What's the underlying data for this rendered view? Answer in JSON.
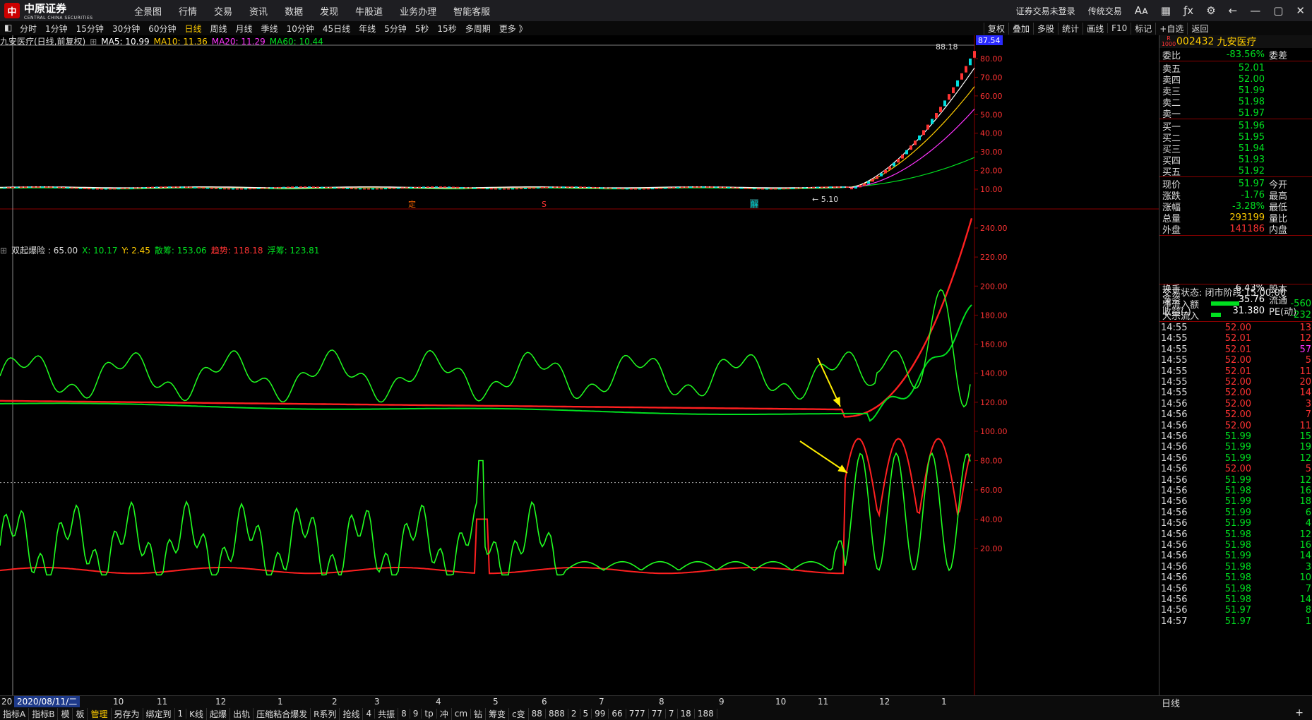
{
  "brand": {
    "name": "中原证券",
    "subtitle": "CENTRAL CHINA SECURITIES"
  },
  "menu": [
    "全景图",
    "行情",
    "交易",
    "资讯",
    "数据",
    "发现",
    "牛股道",
    "业务办理",
    "智能客服"
  ],
  "top_right": {
    "login": "证券交易未登录",
    "mode": "传统交易"
  },
  "periods": [
    "分时",
    "1分钟",
    "15分钟",
    "30分钟",
    "60分钟",
    "日线",
    "周线",
    "月线",
    "季线",
    "10分钟",
    "45日线",
    "年线",
    "5分钟",
    "5秒",
    "15秒",
    "多周期",
    "更多 》"
  ],
  "active_period": "日线",
  "tools": [
    "复权",
    "叠加",
    "多股",
    "统计",
    "画线",
    "F10",
    "标记",
    "+自选",
    "返回"
  ],
  "info": {
    "name": "九安医疗(日线,前复权)",
    "ma5": "MA5: 10.99",
    "ma10": "MA10: 11.36",
    "ma20": "MA20: 11.29",
    "ma60": "MA60: 10.44"
  },
  "indicator": {
    "name": "双起爆险 : 65.00",
    "x": "X: 10.17",
    "y": "Y: 2.45",
    "sanchou": "散筹: 153.06",
    "qushi": "趋势: 118.18",
    "fuchou": "浮筹: 123.81"
  },
  "price_panel": {
    "last_label": "87.54",
    "high_label": "88.18",
    "low_label": "← 5.10",
    "markers": [
      "定",
      "S",
      "解"
    ],
    "y_ticks": [
      "80.00",
      "70.00",
      "60.00",
      "50.00",
      "40.00",
      "30.00",
      "20.00",
      "10.00"
    ]
  },
  "ind_panel": {
    "y_ticks": [
      "240.00",
      "220.00",
      "200.00",
      "180.00",
      "160.00",
      "140.00",
      "120.00",
      "100.00",
      "80.00",
      "60.00",
      "40.00",
      "20.00"
    ]
  },
  "x_axis": {
    "cursor_date": "2020/08/11/二",
    "left_label": "20",
    "labels": [
      "10",
      "11",
      "12",
      "1",
      "2",
      "3",
      "4",
      "5",
      "6",
      "7",
      "8",
      "9",
      "10",
      "11",
      "12",
      "1"
    ],
    "period_tab": "日线"
  },
  "bottom_tabs": [
    "指标A",
    "指标B",
    "模",
    "板",
    "管理",
    "另存为",
    "绑定到",
    "1",
    "K线",
    "起爆",
    "出轨",
    "压缩粘合爆发",
    "R系列",
    "抢线",
    "4",
    "共振",
    "8",
    "9",
    "tp",
    "冲",
    "cm",
    "钻",
    "筹变",
    "c变",
    "88",
    "888",
    "2",
    "5",
    "99",
    "66",
    "777",
    "77",
    "7",
    "18",
    "188"
  ],
  "active_bottom_tab": "管理",
  "stock": {
    "code": "002432",
    "name": "九安医疗",
    "badge": "R 1000"
  },
  "quote": {
    "weibi": {
      "label": "委比",
      "value": "-83.56%",
      "right": "委差"
    },
    "sells": [
      {
        "label": "卖五",
        "price": "52.01"
      },
      {
        "label": "卖四",
        "price": "52.00"
      },
      {
        "label": "卖三",
        "price": "51.99"
      },
      {
        "label": "卖二",
        "price": "51.98"
      },
      {
        "label": "卖一",
        "price": "51.97"
      }
    ],
    "buys": [
      {
        "label": "买一",
        "price": "51.96"
      },
      {
        "label": "买二",
        "price": "51.95"
      },
      {
        "label": "买三",
        "price": "51.94"
      },
      {
        "label": "买四",
        "price": "51.93"
      },
      {
        "label": "买五",
        "price": "51.92"
      }
    ],
    "stats": [
      {
        "label": "现价",
        "value": "51.97",
        "right": "今开",
        "color": "grn"
      },
      {
        "label": "涨跌",
        "value": "-1.76",
        "right": "最高",
        "color": "grn"
      },
      {
        "label": "涨幅",
        "value": "-3.28%",
        "right": "最低",
        "color": "grn"
      },
      {
        "label": "总量",
        "value": "293199",
        "right": "量比",
        "color": "yel"
      },
      {
        "label": "外盘",
        "value": "141186",
        "right": "内盘",
        "color": "red"
      },
      {
        "label": "换手",
        "value": "6.43%",
        "right": "股本",
        "color": "wht"
      },
      {
        "label": "净资",
        "value": "35.76",
        "right": "流通",
        "color": "wht"
      },
      {
        "label": "收益(-)",
        "value": "31.380",
        "right": "PE(动)",
        "color": "wht"
      }
    ],
    "status": "交易状态: 闭市阶段 15:00:00",
    "flows": [
      {
        "label": "净流入额",
        "value": "-560"
      },
      {
        "label": "大宗流入",
        "value": "-232"
      }
    ],
    "ticks": [
      {
        "t": "14:55",
        "p": "52.00",
        "v": "13"
      },
      {
        "t": "14:55",
        "p": "52.01",
        "v": "12"
      },
      {
        "t": "14:55",
        "p": "52.01",
        "v": "57"
      },
      {
        "t": "14:55",
        "p": "52.00",
        "v": "5"
      },
      {
        "t": "14:55",
        "p": "52.01",
        "v": "11"
      },
      {
        "t": "14:55",
        "p": "52.00",
        "v": "20"
      },
      {
        "t": "14:55",
        "p": "52.00",
        "v": "14"
      },
      {
        "t": "14:56",
        "p": "52.00",
        "v": "3"
      },
      {
        "t": "14:56",
        "p": "52.00",
        "v": "7"
      },
      {
        "t": "14:56",
        "p": "52.00",
        "v": "11"
      },
      {
        "t": "14:56",
        "p": "51.99",
        "v": "15"
      },
      {
        "t": "14:56",
        "p": "51.99",
        "v": "19"
      },
      {
        "t": "14:56",
        "p": "51.99",
        "v": "12"
      },
      {
        "t": "14:56",
        "p": "52.00",
        "v": "5"
      },
      {
        "t": "14:56",
        "p": "51.99",
        "v": "12"
      },
      {
        "t": "14:56",
        "p": "51.98",
        "v": "16"
      },
      {
        "t": "14:56",
        "p": "51.99",
        "v": "18"
      },
      {
        "t": "14:56",
        "p": "51.99",
        "v": "6"
      },
      {
        "t": "14:56",
        "p": "51.99",
        "v": "4"
      },
      {
        "t": "14:56",
        "p": "51.98",
        "v": "12"
      },
      {
        "t": "14:56",
        "p": "51.98",
        "v": "16"
      },
      {
        "t": "14:56",
        "p": "51.99",
        "v": "14"
      },
      {
        "t": "14:56",
        "p": "51.98",
        "v": "3"
      },
      {
        "t": "14:56",
        "p": "51.98",
        "v": "10"
      },
      {
        "t": "14:56",
        "p": "51.98",
        "v": "7"
      },
      {
        "t": "14:56",
        "p": "51.98",
        "v": "14"
      },
      {
        "t": "14:56",
        "p": "51.97",
        "v": "8"
      },
      {
        "t": "14:57",
        "p": "51.97",
        "v": "1"
      }
    ]
  },
  "colors": {
    "up": "#ff3333",
    "down": "#00e020",
    "ma5": "#ffffff",
    "ma10": "#ffcc00",
    "ma20": "#ff33ff",
    "ma60": "#00e020",
    "accent": "#ffcc00"
  }
}
